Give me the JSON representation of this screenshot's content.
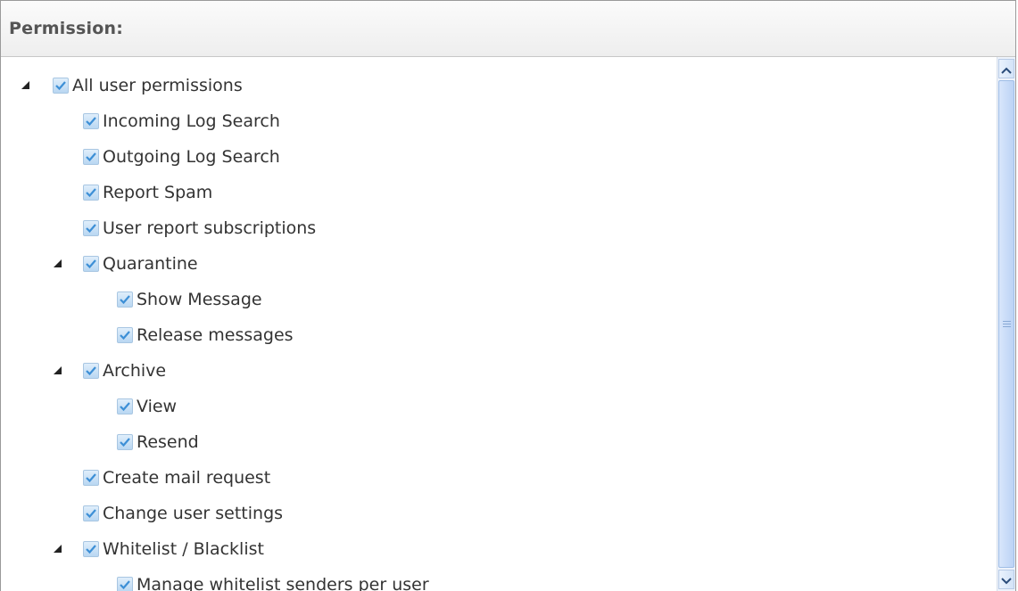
{
  "panel": {
    "title": "Permission:"
  },
  "tree": {
    "root": {
      "label": "All user permissions",
      "checked": true,
      "expanded": true
    },
    "items": [
      {
        "label": "Incoming Log Search",
        "checked": true
      },
      {
        "label": "Outgoing Log Search",
        "checked": true
      },
      {
        "label": "Report Spam",
        "checked": true
      },
      {
        "label": "User report subscriptions",
        "checked": true
      },
      {
        "label": "Quarantine",
        "checked": true,
        "expanded": true,
        "children": [
          {
            "label": "Show Message",
            "checked": true
          },
          {
            "label": "Release messages",
            "checked": true
          }
        ]
      },
      {
        "label": "Archive",
        "checked": true,
        "expanded": true,
        "children": [
          {
            "label": "View",
            "checked": true
          },
          {
            "label": "Resend",
            "checked": true
          }
        ]
      },
      {
        "label": "Create mail request",
        "checked": true
      },
      {
        "label": "Change user settings",
        "checked": true
      },
      {
        "label": "Whitelist / Blacklist",
        "checked": true,
        "expanded": true,
        "children": [
          {
            "label": "Manage whitelist senders per user",
            "checked": true
          }
        ]
      }
    ]
  },
  "icons": {
    "expanded": "triangle-expanded-icon",
    "checked": "checkbox-checked-icon",
    "scroll_up": "chevron-up-icon",
    "scroll_down": "chevron-down-icon"
  },
  "colors": {
    "checkmark": "#3d8fd6",
    "label_text": "#333333",
    "header_text": "#555555"
  }
}
